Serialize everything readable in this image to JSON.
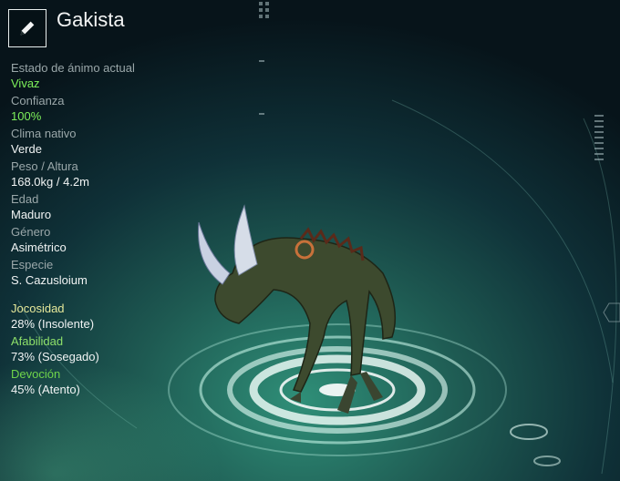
{
  "creature": {
    "name": "Gakista",
    "edit_icon": "pencil-icon"
  },
  "stats": [
    {
      "label": "Estado de ánimo actual",
      "value": "Vivaz",
      "value_color": "#7df05a"
    },
    {
      "label": "Confianza",
      "value": "100%",
      "value_color": "#7df05a"
    },
    {
      "label": "Clima nativo",
      "value": "Verde",
      "value_color": "#f1f4f4"
    },
    {
      "label": "Peso / Altura",
      "value": "168.0kg / 4.2m",
      "value_color": "#f1f4f4"
    },
    {
      "label": "Edad",
      "value": "Maduro",
      "value_color": "#f1f4f4"
    },
    {
      "label": "Género",
      "value": "Asimétrico",
      "value_color": "#f1f4f4"
    },
    {
      "label": "Especie",
      "value": "S. Cazusloium",
      "value_color": "#f1f4f4"
    }
  ],
  "traits": [
    {
      "label": "Jocosidad",
      "value": "28% (Insolente)",
      "label_color": "#e6e89a"
    },
    {
      "label": "Afabilidad",
      "value": "73% (Sosegado)",
      "label_color": "#8ee06a"
    },
    {
      "label": "Devoción",
      "value": "45% (Atento)",
      "label_color": "#6fd44a"
    }
  ]
}
